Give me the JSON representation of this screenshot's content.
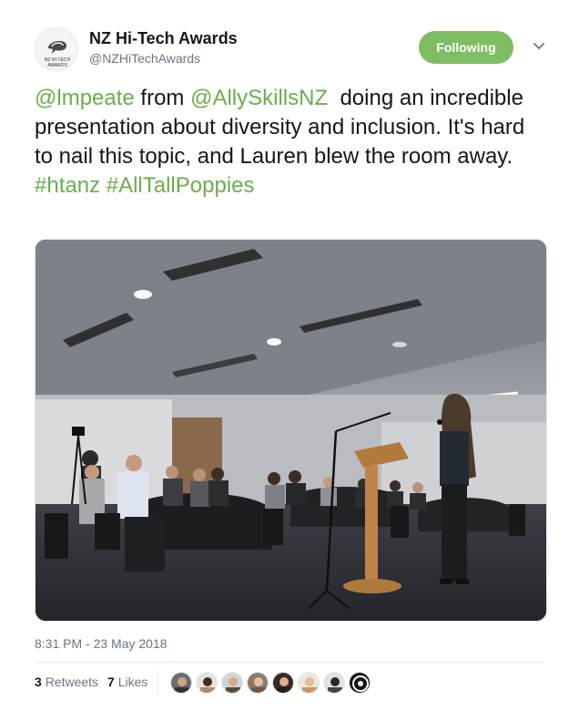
{
  "account": {
    "display_name": "NZ Hi-Tech Awards",
    "handle": "@NZHiTechAwards",
    "avatar_text_line1": "NZ HI-TECH",
    "avatar_text_line2": "AWARDS"
  },
  "follow_button": {
    "label": "Following"
  },
  "tweet": {
    "parts": [
      {
        "type": "mention",
        "text": "@lmpeate"
      },
      {
        "type": "text",
        "text": " from "
      },
      {
        "type": "mention",
        "text": "@AllySkillsNZ"
      },
      {
        "type": "text",
        "text": "  doing an incredible presentation about diversity and inclusion. It's hard to nail this topic, and Lauren blew the room away. "
      },
      {
        "type": "hashtag",
        "text": "#htanz"
      },
      {
        "type": "text",
        "text": " "
      },
      {
        "type": "hashtag",
        "text": "#AllTallPoppies"
      }
    ]
  },
  "timestamp": "8:31 PM - 23 May 2018",
  "stats": {
    "retweets_count": "3",
    "retweets_label": "Retweets",
    "likes_count": "7",
    "likes_label": "Likes"
  },
  "colors": {
    "accent": "#6aae4c",
    "follow_bg": "#7fbd63",
    "secondary_text": "#657786"
  }
}
